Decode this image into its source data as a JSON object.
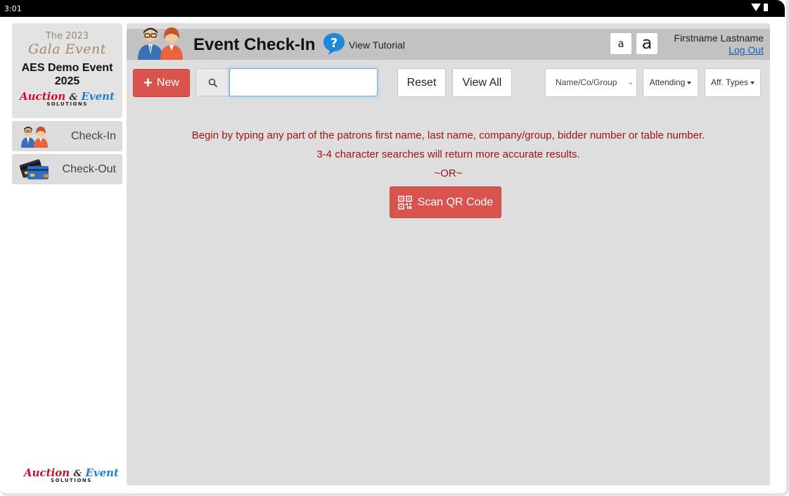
{
  "status_bar": {
    "time": "3:01",
    "icons": [
      "wifi-icon",
      "battery-icon"
    ]
  },
  "sidebar": {
    "event_card": {
      "gala_year": "The 2023",
      "gala_name": "Gala Event",
      "event_title": "AES Demo Event 2025",
      "brand": {
        "auction": "Auction",
        "amp": "&",
        "event": "Event",
        "solutions": "SOLUTIONS"
      }
    },
    "items": [
      {
        "label": "Check-In",
        "icon": "people-icon"
      },
      {
        "label": "Check-Out",
        "icon": "credit-card-icon"
      }
    ],
    "footer_brand": {
      "auction": "Auction",
      "amp": "&",
      "event": "Event",
      "solutions": "SOLUTIONS"
    }
  },
  "header": {
    "title": "Event Check-In",
    "tutorial_label": "View Tutorial",
    "font_small": "a",
    "font_large": "a",
    "user_name": "Firstname Lastname",
    "logout_label": "Log Out"
  },
  "toolbar": {
    "new_label": "New",
    "search_value": "",
    "reset_label": "Reset",
    "view_all_label": "View All",
    "search_by_selected": "Name/Co/Group",
    "attending_label": "Attending",
    "aff_types_label": "Aff. Types"
  },
  "messages": {
    "line1": "Begin by typing any part of the patrons first name, last name, company/group, bidder number or table number.",
    "line2": "3-4 character searches will return more accurate results.",
    "line3": "~OR~",
    "scan_label": "Scan QR Code"
  },
  "colors": {
    "accent_red": "#d9534f",
    "message_red": "#a11313",
    "panel_gray": "#dedede",
    "header_gray": "#c2c2c2",
    "link_blue": "#1a5fb4"
  }
}
